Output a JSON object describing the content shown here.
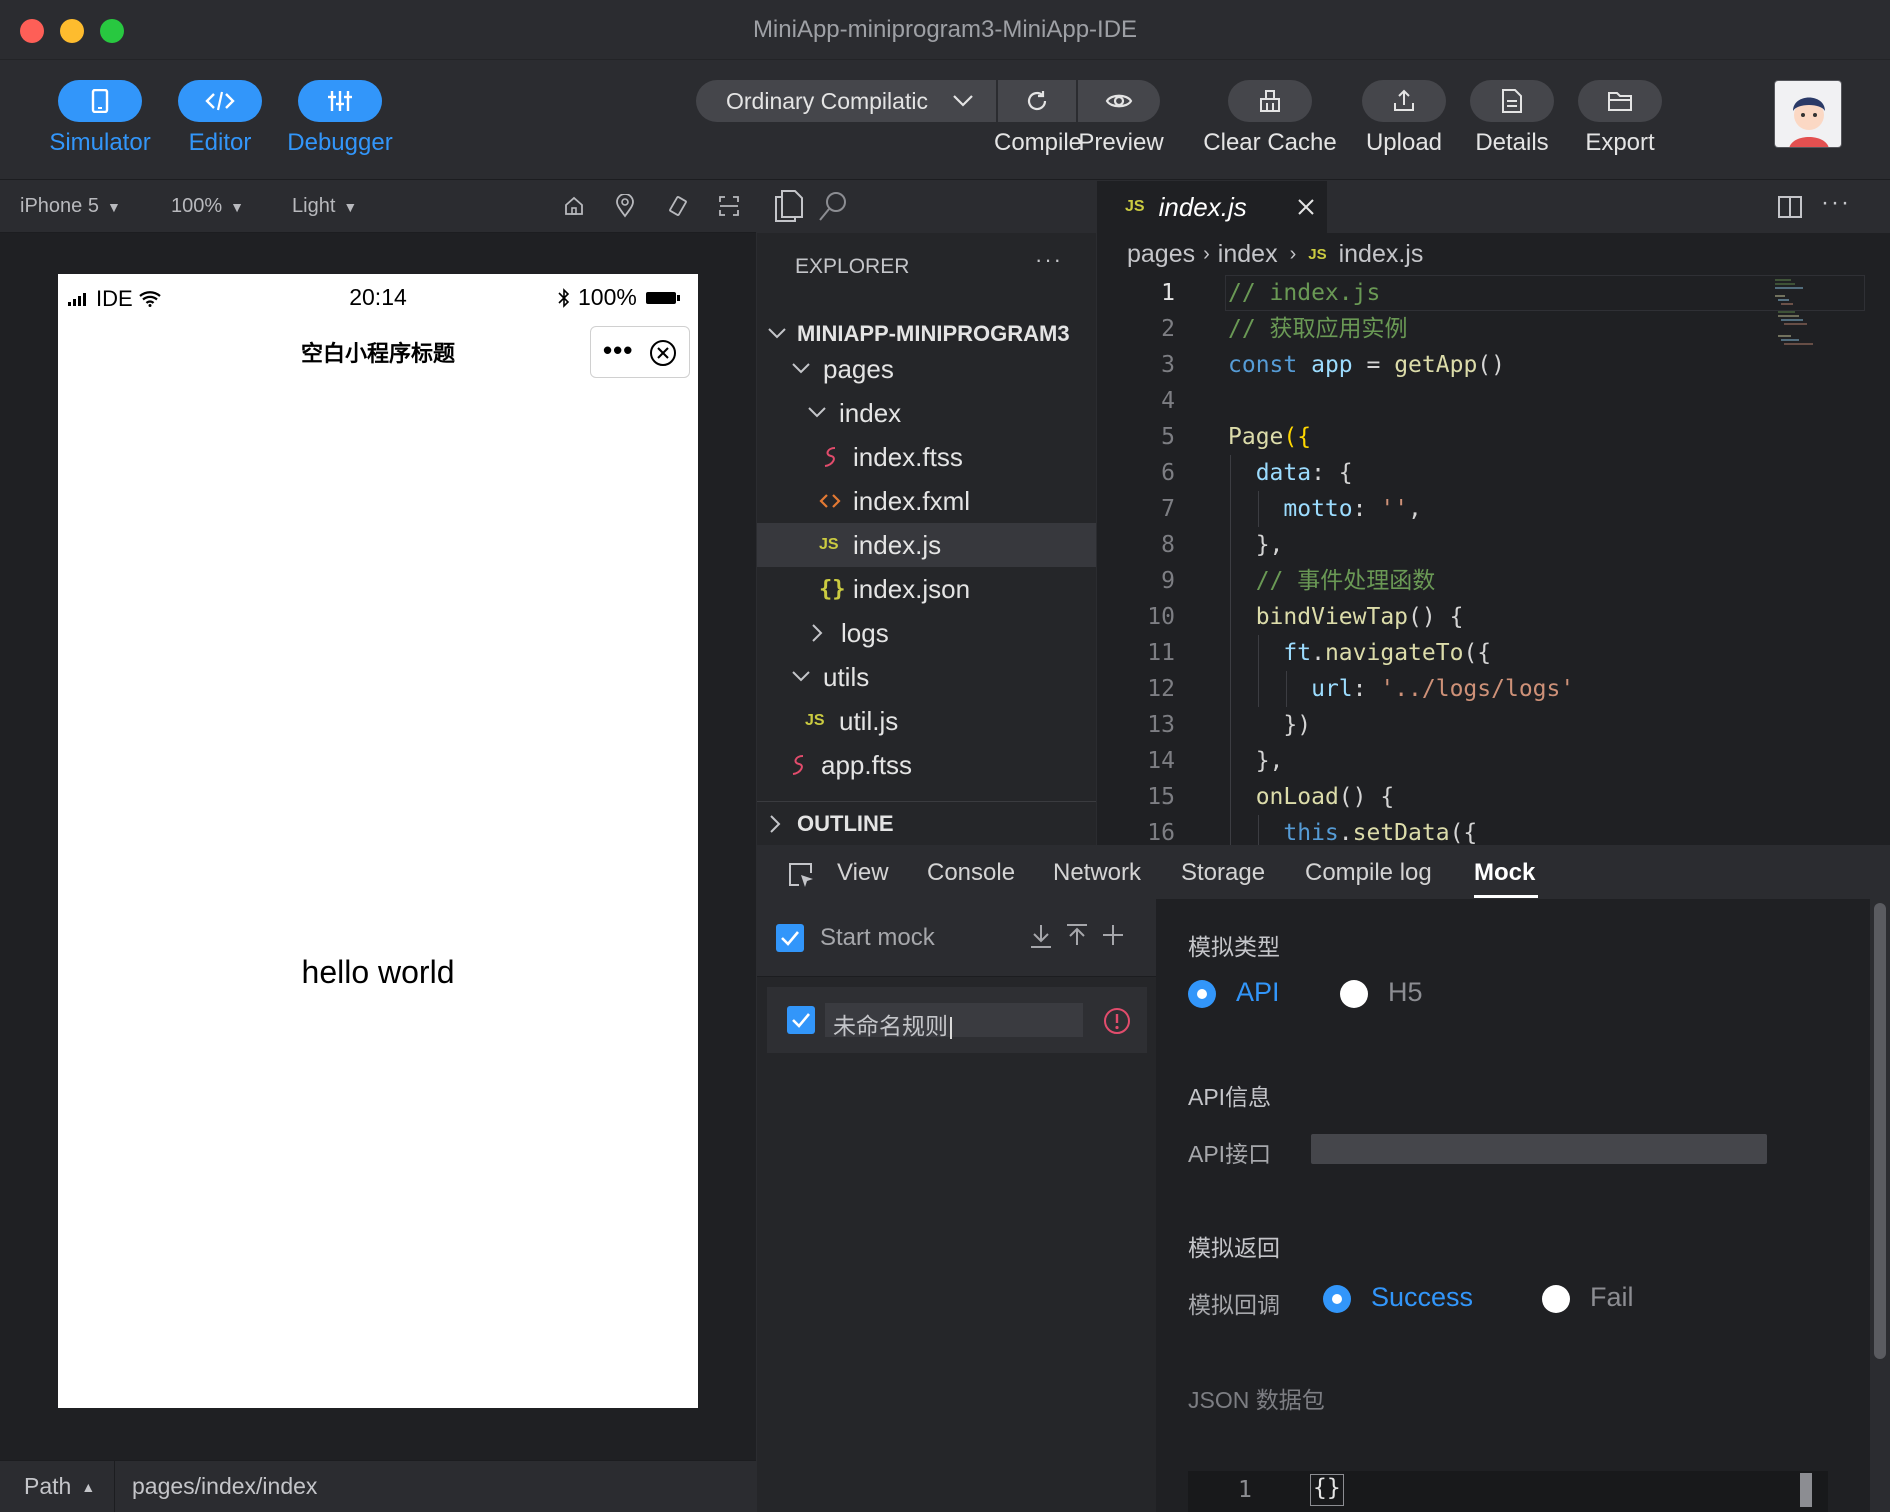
{
  "window": {
    "title": "MiniApp-miniprogram3-MiniApp-IDE"
  },
  "toolbar": {
    "simulator": "Simulator",
    "editor": "Editor",
    "debugger": "Debugger",
    "compile_mode": "Ordinary Compilatic",
    "compile": "Compile",
    "preview": "Preview",
    "clear_cache": "Clear Cache",
    "upload": "Upload",
    "details": "Details",
    "export": "Export"
  },
  "simulator": {
    "device": "iPhone 5",
    "zoom": "100%",
    "theme": "Light",
    "status_carrier": "IDE",
    "status_time": "20:14",
    "status_battery": "100%",
    "nav_title": "空白小程序标题",
    "content_text": "hello world"
  },
  "pathbar": {
    "label": "Path",
    "value": "pages/index/index"
  },
  "explorer": {
    "header": "EXPLORER",
    "project": "MINIAPP-MINIPROGRAM3",
    "items": [
      {
        "label": "pages"
      },
      {
        "label": "index"
      },
      {
        "label": "index.ftss"
      },
      {
        "label": "index.fxml"
      },
      {
        "label": "index.js"
      },
      {
        "label": "index.json"
      },
      {
        "label": "logs"
      },
      {
        "label": "utils"
      },
      {
        "label": "util.js"
      },
      {
        "label": "app.ftss"
      }
    ],
    "outline": "OUTLINE"
  },
  "editor": {
    "tab": "index.js",
    "breadcrumb": [
      "pages",
      "index",
      "index.js"
    ],
    "line_numbers": [
      "1",
      "2",
      "3",
      "4",
      "5",
      "6",
      "7",
      "8",
      "9",
      "10",
      "11",
      "12",
      "13",
      "14",
      "15",
      "16"
    ]
  },
  "panel": {
    "tabs": [
      "View",
      "Console",
      "Network",
      "Storage",
      "Compile log",
      "Mock"
    ],
    "start_mock": "Start mock",
    "rule_name": "未命名规则",
    "mock_type_label": "模拟类型",
    "type_api": "API",
    "type_h5": "H5",
    "api_info_label": "API信息",
    "api_endpoint_label": "API接口",
    "mock_return_label": "模拟返回",
    "mock_callback_label": "模拟回调",
    "success": "Success",
    "fail": "Fail",
    "json_label": "JSON 数据包",
    "json_line": "1",
    "json_value": "{}"
  },
  "colors": {
    "accent": "#3296fa",
    "background": "#1f2023",
    "panel": "#2b2c30"
  }
}
